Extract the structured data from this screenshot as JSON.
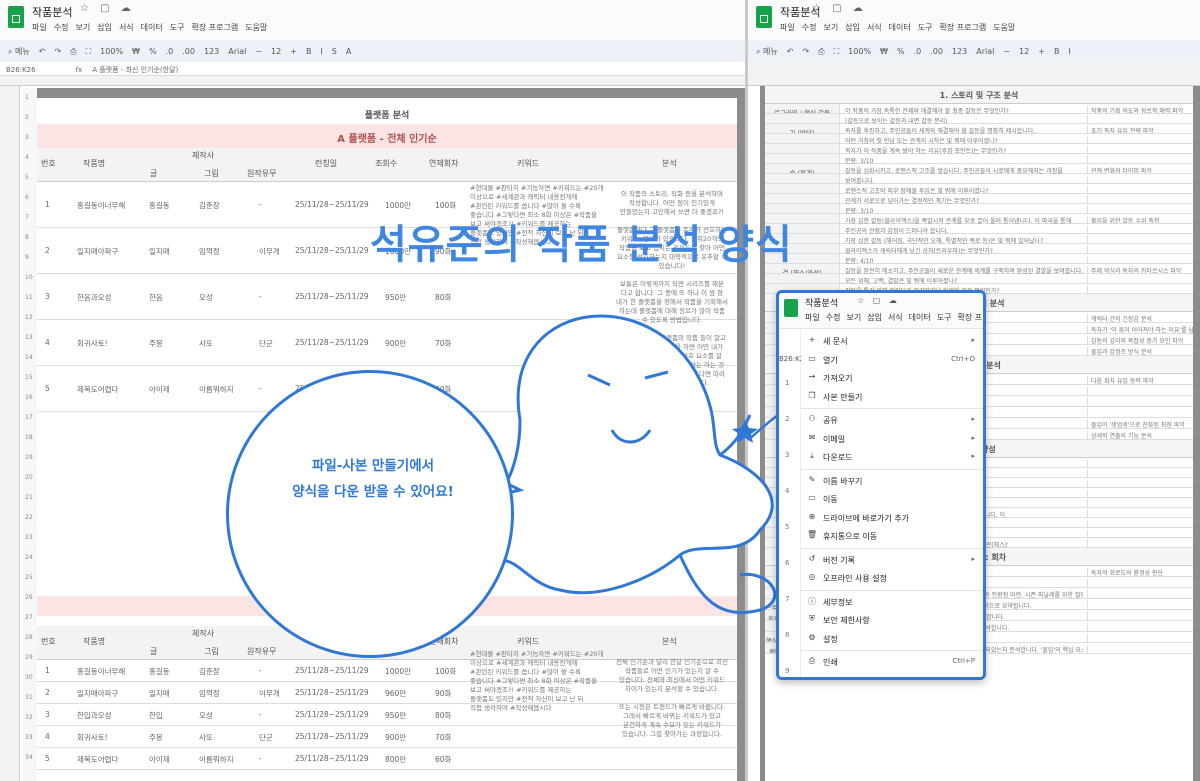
{
  "left": {
    "doc_title": "작품분석",
    "title_icons": "☆ ▢ ☁",
    "menu": [
      "파일",
      "수정",
      "보기",
      "삽입",
      "서식",
      "데이터",
      "도구",
      "확장 프로그램",
      "도움말"
    ],
    "tools": [
      "⌕ 메뉴",
      "↶",
      "↷",
      "⎙",
      "⛶",
      "100%",
      "₩",
      "%",
      ".0",
      ".00",
      "123",
      "Arial",
      "−",
      "12",
      "+",
      "B",
      "I",
      "S",
      "A"
    ],
    "cell_ref": "B26:K26",
    "formula": "A 플랫폼 - 최신 인기순(한달)",
    "sheet_title": "플랫폼 분석",
    "section1": "A 플랫폼 - 전체 인기순",
    "section2": "A 플랫폼 - 최신 인기순(한달)",
    "headers": {
      "no": "번호",
      "work": "작품명",
      "author": "제작사",
      "writer": "글",
      "art": "그림",
      "original": "원작유무",
      "period": "런칭일",
      "views": "조회수",
      "episodes": "연재회차",
      "keyword": "키워드",
      "analysis": "분석"
    },
    "rows_top": [
      {
        "no": "1",
        "work": "홍길동이너무해",
        "writer": "홍길동",
        "art": "김춘장",
        "orig": "-",
        "period": "25/11/28~25/11/29",
        "views": "1000만",
        "eps": "100화"
      },
      {
        "no": "2",
        "work": "일지매아파구",
        "writer": "일지매",
        "art": "임꺽정",
        "orig": "이무개",
        "period": "25/11/28~25/11/29",
        "views": "1000만",
        "eps": "90화"
      },
      {
        "no": "3",
        "work": "한음과오성",
        "writer": "한음",
        "art": "오성",
        "orig": "-",
        "period": "25/11/28~25/11/29",
        "views": "950만",
        "eps": "80화"
      },
      {
        "no": "4",
        "work": "회귀사토!",
        "writer": "주몽",
        "art": "사또",
        "orig": "단군",
        "period": "25/11/28~25/11/29",
        "views": "900만",
        "eps": "70화"
      },
      {
        "no": "5",
        "work": "제목도어렵다",
        "writer": "아이제",
        "art": "이름뭐하지",
        "orig": "-",
        "period": "25/11/28~25/11/29",
        "views": "800만",
        "eps": "60화"
      }
    ],
    "keywords_top": [
      "#현대물 #판타지 #기능자면 #키워드는 #20개",
      "이상으로 #세계관과 캐릭터 내용전개에",
      "#관련된 키워드를 씁니다 #많이 쓸 수록",
      "좋습니다 #그렇다면 최소 8화 이상은 #작품을",
      "보고 써야겠조?! #키워드를 제공하는",
      "플랫폼도 있지만 #전적 자신이 보고 난 뒤",
      "직접 생각하여 #작성해봅시다"
    ],
    "analysis_top": [
      "이 작품의 스토리, 작화 등을 분석하며",
      "작성합니다. 어떤 점이 인기있게",
      "만들었는지 고민해서 쓰면 더 좋겠죠?!",
      "",
      "플랫폼마다 그 플랫폼과 독자가 선호하는",
      "키워드, 장르가 있습니다. 상위20개의",
      "작품을 보고 겹치는 키워드를 찾아 어떤",
      "요소를 선호하는지 대략적으로 유추할 수",
      "있습니다!",
      "",
      "보통은 이렇게까지 되면 시리즈를 해본",
      "다고 합니다. 그 중에 또 하나 이 쌈 항",
      "내가 한 플랫폼을 정해서 작품을 기획해서",
      "하는데 플랫폼에 대해 장르가 많이 작품",
      "수 있도록 방법입니다.",
      "",
      "또한 어느 정도 플랫폼의 작품 들이 알고",
      "있다고 해도 이 분석을 하면 어떤 내가",
      "모르는 작품이 독자의 선호 요소를 알",
      "수 있습니다. 이 분석을 하셔는 아는 것",
      "무엇인지 작품이 왜 인기인지 다면 따라",
      "도움이 될 거라 생각합니다."
    ],
    "rows_bottom": [
      {
        "no": "1",
        "work": "홍길동이너무해",
        "writer": "홍길동",
        "art": "김춘장",
        "orig": "-",
        "period": "25/11/28~25/11/29",
        "views": "1000만",
        "eps": "100화"
      },
      {
        "no": "2",
        "work": "일지매아파구",
        "writer": "일지매",
        "art": "임꺽정",
        "orig": "이무개",
        "period": "25/11/28~25/11/29",
        "views": "960만",
        "eps": "90화"
      },
      {
        "no": "3",
        "work": "한입과오성",
        "writer": "한입",
        "art": "오성",
        "orig": "-",
        "period": "25/11/28~25/11/29",
        "views": "950만",
        "eps": "80화"
      },
      {
        "no": "4",
        "work": "회귀사토!",
        "writer": "주몽",
        "art": "사또",
        "orig": "단군",
        "period": "25/11/28~25/11/29",
        "views": "900만",
        "eps": "70화"
      },
      {
        "no": "5",
        "work": "제목도어렵다",
        "writer": "아이제",
        "art": "이름뭐하지",
        "orig": "-",
        "period": "25/11/28~25/11/29",
        "views": "800만",
        "eps": "60화"
      }
    ],
    "analysis_bottom": [
      "전체 인기순과 달리 한달 인기순으로 최신",
      "작품들로 어떤 인기가 있는지 알 수",
      "있습니다. 전체와 최신에서 어떤 키워드",
      "차이가 있는지 분석할 수 있습니다.",
      "",
      "또는 시장은 트렌드가 빠르게 바뀝니다.",
      "그래서 빠르게 바뀌는 키워드가 있고",
      "굳건하게 계속 수요가 있는 키워드가",
      "있습니다. 그걸 찾아가는 과정입니다."
    ],
    "row_numbers": [
      "1",
      "2",
      "3",
      "4",
      "5",
      "6",
      "7",
      "8",
      "9",
      "10",
      "11",
      "12",
      "13",
      "14",
      "15",
      "16",
      "17",
      "18",
      "19",
      "20",
      "21",
      "22",
      "23",
      "24",
      "25",
      "26",
      "27",
      "28",
      "29",
      "30",
      "31",
      "32",
      "33",
      "34"
    ]
  },
  "right": {
    "doc_title": "작품분석",
    "title_icons": "☆ ▢ ☁",
    "menu": [
      "파일",
      "수정",
      "보기",
      "삽입",
      "서식",
      "데이터",
      "도구",
      "확장 프로그램",
      "도움말"
    ],
    "tools": [
      "⌕ 메뉴",
      "↶",
      "↷",
      "⎙",
      "⛶",
      "100%",
      "₩",
      "%",
      ".0",
      ".00",
      "123",
      "Arial",
      "−",
      "12",
      "+",
      "B",
      "I"
    ],
    "section1": "1. 스토리 및 구조 분석",
    "rows": [
      {
        "label": "로그라인 / 핵심 갈등",
        "text": "이 작품의 가장 독특한 전제와 해결해야 할 최종 갈등은 무엇인가?",
        "side": "작품의 기획 의도와 장르적 매력 파악"
      },
      {
        "label": "",
        "text": "(갈등으로 보이는 갈등과 내면 갈등 분리)",
        "side": ""
      },
      {
        "label": "기 (발단)",
        "text": "독자를 후킹하고, 주인공들이 세계와 해결해야 할 갈등을 명확히 제시합니다.",
        "side": "초기 독자 유입 전략 파악"
      },
      {
        "label": "",
        "text": "어떤 거창의 첫 만남 또는 관계의 시작은 및 뭐에 이루어졌나?",
        "side": ""
      },
      {
        "label": "",
        "text": "독자가 이 작품을 계속 봐야 하는 이유(후킹 포인트)는 무엇인가?",
        "side": ""
      },
      {
        "label": "",
        "text": "분량: 3/10",
        "side": ""
      },
      {
        "label": "승 (전개)",
        "text": "갈등을 심화시키고, 로맨스적 고조를 쌓습니다. 주인공들이 시로에게 중요해지는 과정을",
        "side": "관계 변화의 타이밍 파악"
      },
      {
        "label": "",
        "text": "보여줍니다.",
        "side": ""
      },
      {
        "label": "",
        "text": "로맨스적 고조와 외부 장애물 투입은 및 뭐에 이루어졌나?",
        "side": ""
      },
      {
        "label": "",
        "text": "관계가 서로으로 넘어가는 결정적인 계기는 무엇인가?",
        "side": ""
      },
      {
        "label": "",
        "text": "분량: 3/10",
        "side": ""
      },
      {
        "label": "",
        "text": "가장 심한 갈등(클라이맥스)을 폭발시켜 관계를 부로 끌어 올려 통어냅니다. 이 파국을 통해",
        "side": "몰입을 위한 갈등 수위 측정"
      },
      {
        "label": "",
        "text": "주인공의 관점과 감정이 드러나야 합니다.",
        "side": ""
      },
      {
        "label": "",
        "text": "가장 심한 갈등 (해어짐, 극단적인 오해, 특별적인 폭로 등)은 및 뭐에 일어났나?",
        "side": ""
      },
      {
        "label": "",
        "text": "클라이맥스가 캐릭터에게 남긴 상처(트라우마)는 무엇인가?",
        "side": ""
      },
      {
        "label": "",
        "text": "분량: 4/10",
        "side": ""
      },
      {
        "label": "결 (해소/완성)",
        "text": "갈등을 완전히 해소하고, 주인공들이 새로운 관계에 세계를 구축하며 완성된 결말을 보여줍니다.",
        "side": "주제 의식과 독자의 카타르시스 파악"
      },
      {
        "label": "",
        "text": "모든 위해, 고백, 결말은 및 뭐에 이루어졌나?",
        "side": ""
      },
      {
        "label": "",
        "text": "갈등을 통기 위해 캐릭터가 포기하거나 희생한 것은 무엇인가?",
        "side": ""
      }
    ],
    "section2": "2. 캐릭터 분석",
    "rows2": [
      {
        "label": "",
        "text": "캐릭터 각각 목표 무엇인가?",
        "side": "캐릭터 간의 긴장감 분석"
      },
      {
        "label": "",
        "text": "독자가 '이 혹이 이어져야 하는 이유'를",
        "side": "독자가 '이 혹이 이어져야 하는 이유'를 납득하는 요인 분석"
      },
      {
        "label": "",
        "text": "감동적으로 분석",
        "side": "감동의 깊이와 복잡성 증가 요인 파악"
      },
      {
        "label": "",
        "text": "시키는 데 몇 화가 걸렸는가?",
        "side": "몰입과 감정조 방식 분석"
      }
    ],
    "section3": "3. 구성 분석",
    "rows3": [
      {
        "label": "",
        "text": "인물의 이야기가 주인공이",
        "side": "다음 회차 유입 동력 파악"
      },
      {
        "label": "",
        "text": "장르가 전개 기법입니다.",
        "side": ""
      },
      {
        "label": "",
        "text": "그 연출이 독자나 시청자를",
        "side": ""
      },
      {
        "label": "",
        "text": "",
        "side": ""
      },
      {
        "label": "",
        "text": "연출 목적은 무엇인가?",
        "side": "몰입이 '생업생'으로 진화된 최장 파악"
      },
      {
        "label": "",
        "text": "이 작품을 보게 만드는 도구로 쓰였는가?",
        "side": "상세적 연출의 기능 분석"
      }
    ],
    "section4": "4. 방향성",
    "rows4": [
      {
        "label": "",
        "text": "타이밍에 일어납니다.",
        "side": ""
      },
      {
        "label": "",
        "text": "선이 회차당 어디에 위치했는지 확인하고,",
        "side": ""
      },
      {
        "label": "",
        "text": "",
        "side": ""
      },
      {
        "label": "",
        "text": "은 방향 중 주는 장면이 및 뭐에 몰려 있었는지 파악하고,",
        "side": ""
      },
      {
        "label": "",
        "text": "",
        "side": ""
      },
      {
        "label": "",
        "text": "전환 연출 (화면 구성, 구도, 인물의 표정)에 집중해야 합니다. 이",
        "side": ""
      },
      {
        "label": "",
        "text": "이 가장 큰 공부가 됩니다.",
        "side": ""
      },
      {
        "label": "",
        "text": "",
        "side": ""
      },
      {
        "label": "",
        "text": "카타르시스)을 수었는지 파악하고, 그 보상을 내 작품의 '관(채스)'",
        "side": ""
      }
    ],
    "section5": "5. 방향성: 회차",
    "rows5": [
      {
        "label": "",
        "text": "",
        "side": "독자의 회로도와 환경성 판단"
      },
      {
        "label": "회차의 계량",
        "text": "하나 사건이 지금 이 회차에 필요했는가?에 답합니다.",
        "side": ""
      },
      {
        "label": "",
        "text": "(예. 조연 독자 유입을 위한 관계적 후킹 투하. 중반부 갈등 전환점 마련. 시즌 피날레를 위한 절망감 극대화)",
        "side": ""
      },
      {
        "label": "스토리 기능 / 주요 사건 요약",
        "text": "이 회차에서 주인공들에게 무슨 일이 일어났는지를 객관적으로 요약합니다.",
        "side": ""
      },
      {
        "label": "후킹 포인트 / 클리프행어",
        "text": "이 회차의 마지막 장면(클리프행어)가 무엇이었는지 기록합니다.",
        "side": ""
      },
      {
        "label": "",
        "text": "독자들이 다음 화를 결제하게 만드는 장치가 무엇인지 분석합니다.",
        "side": ""
      },
      {
        "label": "핵심 로맨스 감동 / 텐션 요소",
        "text": "캐릭터의 부일한 로맨스적 핵심을 기록합니다.",
        "side": ""
      },
      {
        "label": "캐릭터의 결정 자극/해소 여부",
        "text": "캐릭터의 내면의 결핍이 자극되었는지, 아니면 잠시 해소되었는지 분석합니다. '몰입'의 핵심 요소입니다.",
        "side": ""
      }
    ]
  },
  "overlay": {
    "big_title": "석유준의 작품 분석 양식",
    "bubble_line1": "파일-사본 만들기에서",
    "bubble_line2": "양식을 다운 받을 수 있어요!"
  },
  "popup": {
    "title": "작품분석",
    "title_icons": "☆ ▢ ☁",
    "menu": [
      "파일",
      "수정",
      "보기",
      "삽입",
      "서식",
      "데이터",
      "도구",
      "확장 프"
    ],
    "cell_ref": "B26:K2",
    "row_labels": [
      "1",
      "2",
      "3",
      "4",
      "5",
      "6",
      "7",
      "8",
      "9"
    ],
    "items": [
      {
        "icon": "+",
        "label": "새 문서",
        "right": "▸",
        "name": "menu-new"
      },
      {
        "icon": "▭",
        "label": "열기",
        "right": "Ctrl+O",
        "name": "menu-open"
      },
      {
        "icon": "→",
        "label": "가져오기",
        "right": "",
        "name": "menu-import"
      },
      {
        "icon": "❐",
        "label": "사본 만들기",
        "right": "",
        "name": "menu-make-copy"
      },
      {
        "icon": "⚇",
        "label": "공유",
        "right": "▸",
        "name": "menu-share"
      },
      {
        "icon": "✉",
        "label": "이메일",
        "right": "▸",
        "name": "menu-email"
      },
      {
        "icon": "⤓",
        "label": "다운로드",
        "right": "▸",
        "name": "menu-download"
      },
      {
        "icon": "✎",
        "label": "이름 바꾸기",
        "right": "",
        "name": "menu-rename"
      },
      {
        "icon": "▭",
        "label": "이동",
        "right": "",
        "name": "menu-move"
      },
      {
        "icon": "⊕",
        "label": "드라이브에 바로가기 추가",
        "right": "",
        "name": "menu-add-shortcut"
      },
      {
        "icon": "🗑",
        "label": "휴지통으로 이동",
        "right": "",
        "name": "menu-trash"
      },
      {
        "icon": "↺",
        "label": "버전 기록",
        "right": "▸",
        "name": "menu-version-history"
      },
      {
        "icon": "◎",
        "label": "오프라인 사용 설정",
        "right": "",
        "name": "menu-offline"
      },
      {
        "icon": "ⓘ",
        "label": "세부정보",
        "right": "",
        "name": "menu-details"
      },
      {
        "icon": "⛨",
        "label": "보안 제한사항",
        "right": "",
        "name": "menu-security"
      },
      {
        "icon": "⚙",
        "label": "설정",
        "right": "",
        "name": "menu-settings"
      },
      {
        "icon": "⎙",
        "label": "인쇄",
        "right": "Ctrl+P",
        "name": "menu-print"
      }
    ]
  },
  "colors": {
    "accent": "#2f78d8",
    "title": "#3f86e0",
    "pink": "#fce4e4",
    "green": "#16a34a"
  }
}
